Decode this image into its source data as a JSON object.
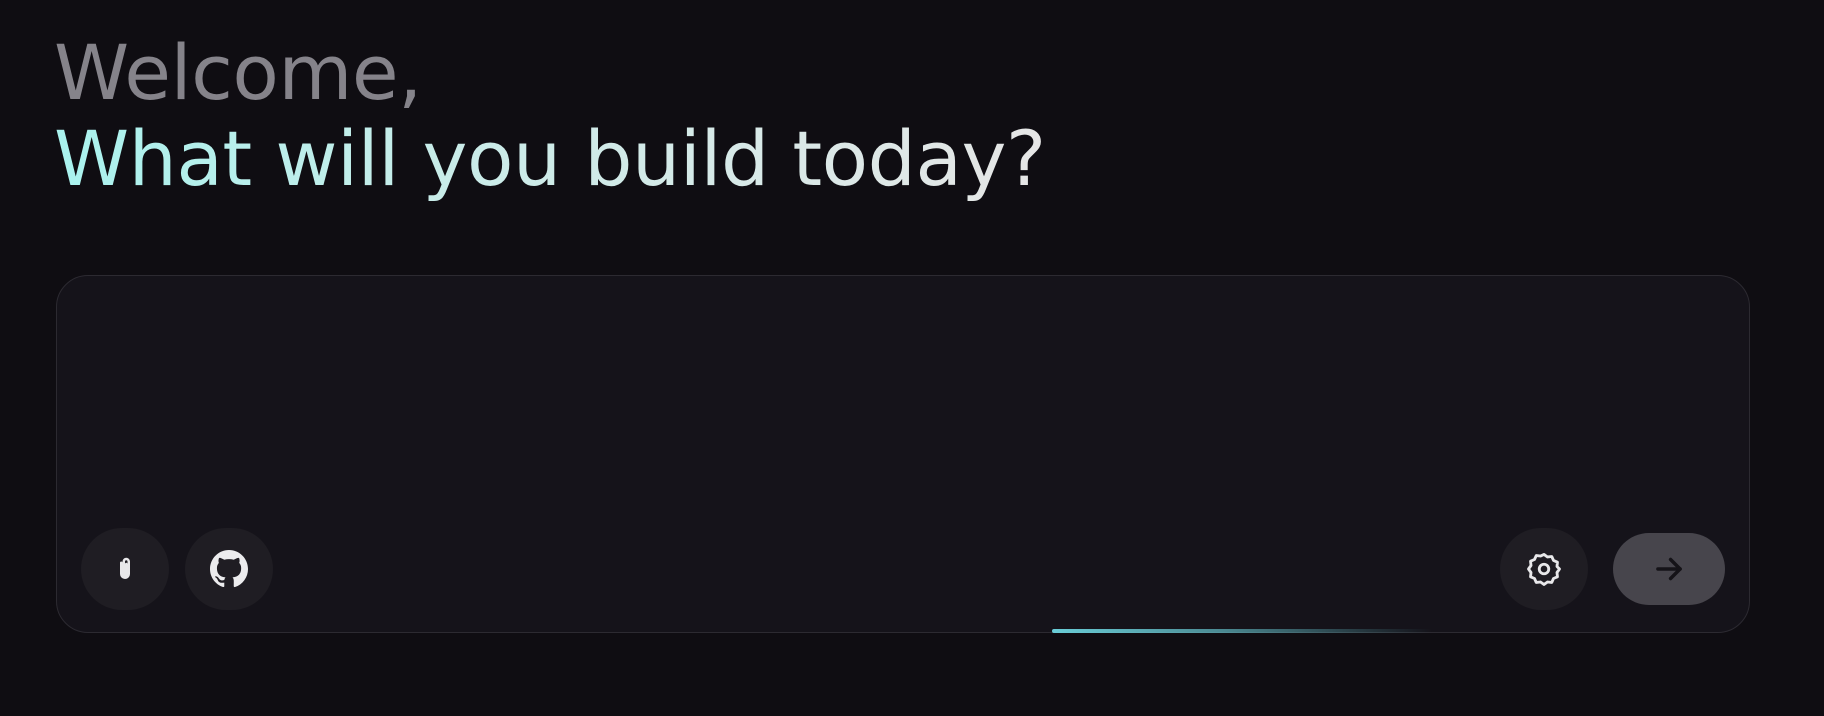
{
  "greeting": {
    "line1": "Welcome,",
    "line2": "What will you build today?"
  },
  "prompt": {
    "value": "",
    "placeholder": ""
  },
  "toolbar": {
    "attach_icon": "paperclip-icon",
    "github_icon": "github-icon",
    "settings_icon": "gear-icon",
    "send_icon": "arrow-right-icon"
  },
  "colors": {
    "background": "#0f0d12",
    "panel": "#15131a",
    "accent": "#6ed7e1",
    "heading_muted": "#85838a",
    "send_button": "#47454c"
  }
}
